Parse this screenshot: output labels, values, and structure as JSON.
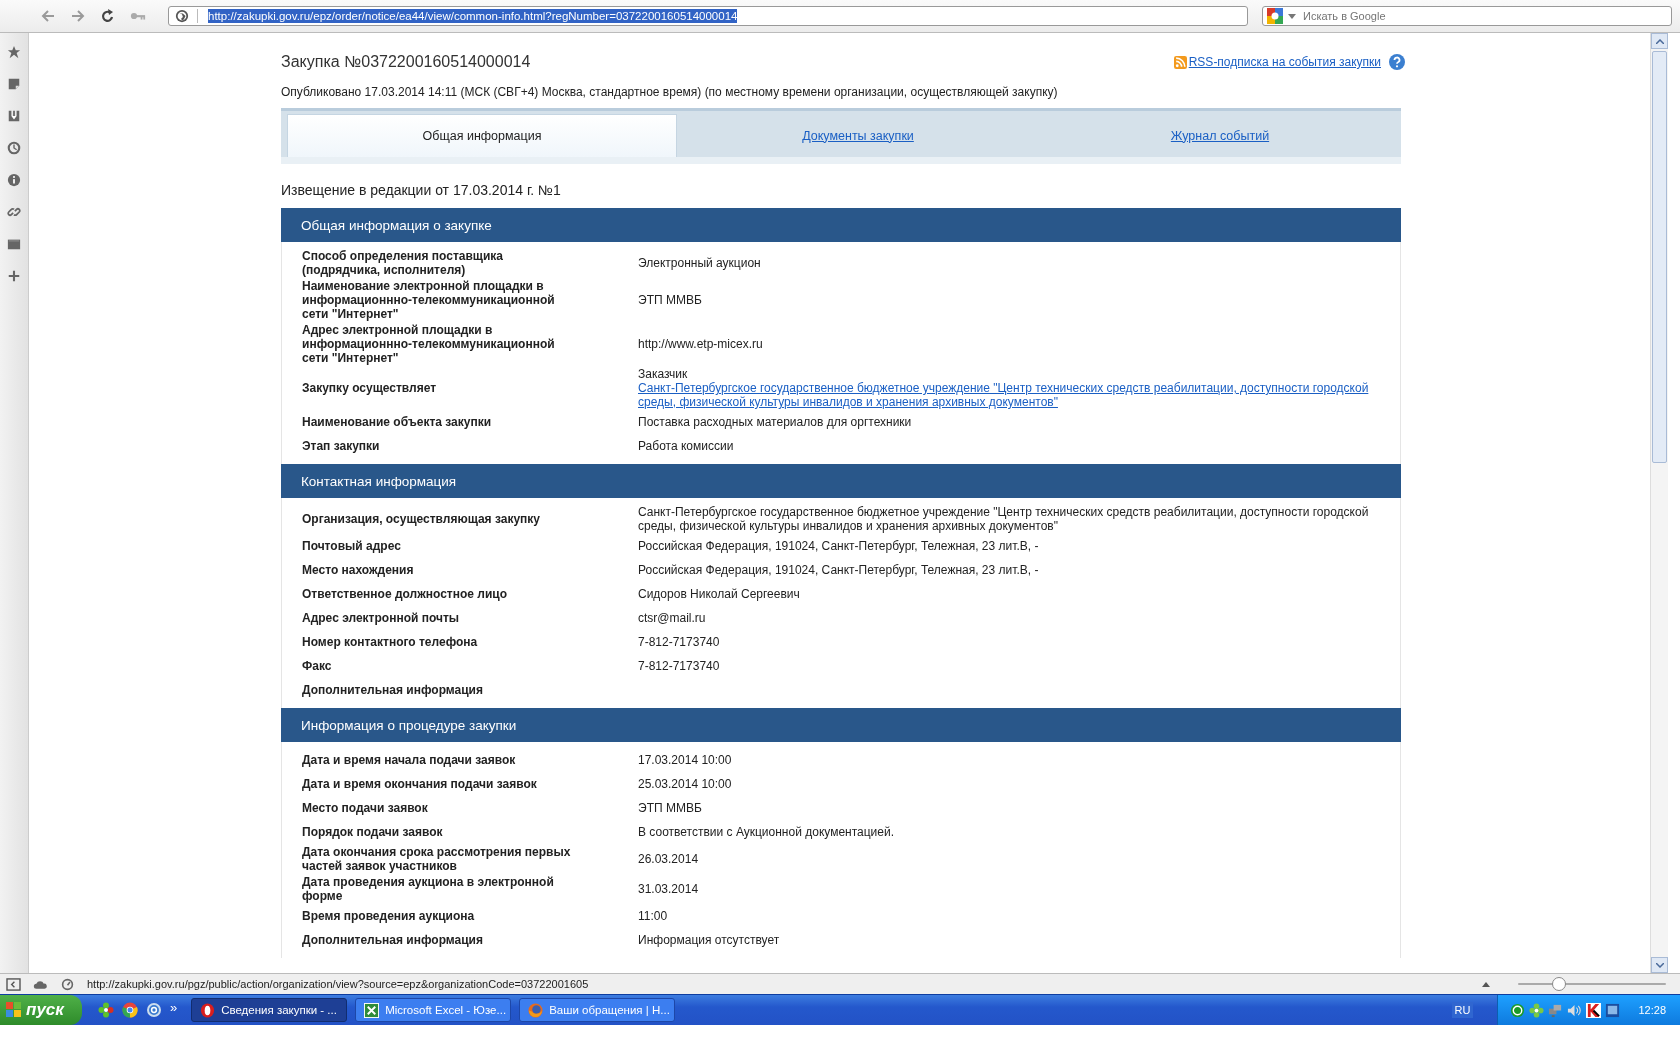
{
  "browser": {
    "address": "http://zakupki.gov.ru/epz/order/notice/ea44/view/common-info.html?regNumber=0372200160514000014",
    "search": {
      "placeholder": "Искать в Google"
    }
  },
  "page": {
    "title": "Закупка №0372200160514000014",
    "rss_link": "RSS-подписка на события закупки",
    "published": "Опубликовано 17.03.2014 14:11 (МСК (СВГ+4) Москва, стандартное время) (по местному времени организации, осуществляющей закупку)",
    "tabs": [
      {
        "label": "Общая информация",
        "selected": true
      },
      {
        "label": "Документы закупки",
        "selected": false
      },
      {
        "label": "Журнал событий",
        "selected": false
      }
    ],
    "notice": "Извещение в редакции от 17.03.2014 г. №1",
    "sections": [
      {
        "title": "Общая информация о закупке",
        "rows": [
          {
            "label": "Способ определения поставщика (подрядчика, исполнителя)",
            "value": "Электронный аукцион",
            "link": false
          },
          {
            "label": "Наименование электронной площадки в информационнно-телекоммуникационной сети \"Интернет\"",
            "value": "ЭТП ММВБ",
            "link": false
          },
          {
            "label": "Адрес электронной площадки в информационнно-телекоммуникационной сети \"Интернет\"",
            "value": "http://www.etp-micex.ru",
            "link": false
          },
          {
            "label": "Закупку осуществляет",
            "note": "Заказчик",
            "value": "Санкт-Петербургское государственное бюджетное учреждение \"Центр технических средств реабилитации, доступности городской среды, физической культуры инвалидов и хранения архивных документов\"",
            "link": true
          },
          {
            "label": "Наименование объекта закупки",
            "value": "Поставка расходных материалов для оргтехники",
            "link": false
          },
          {
            "label": "Этап закупки",
            "value": "Работа комиссии",
            "link": false
          }
        ]
      },
      {
        "title": "Контактная информация",
        "rows": [
          {
            "label": "Организация, осуществляющая закупку",
            "value": "Санкт-Петербургское государственное бюджетное учреждение \"Центр технических средств реабилитации, доступности городской среды, физической культуры инвалидов и хранения архивных документов\"",
            "link": false
          },
          {
            "label": "Почтовый адрес",
            "value": "Российская Федерация, 191024, Санкт-Петербург, Тележная, 23 лит.В, -",
            "link": false
          },
          {
            "label": "Место нахождения",
            "value": "Российская Федерация, 191024, Санкт-Петербург, Тележная, 23 лит.В, -",
            "link": false
          },
          {
            "label": "Ответственное должностное лицо",
            "value": "Сидоров Николай Сергеевич",
            "link": false
          },
          {
            "label": "Адрес электронной почты",
            "value": "ctsr@mail.ru",
            "link": false
          },
          {
            "label": "Номер контактного телефона",
            "value": "7-812-7173740",
            "link": false
          },
          {
            "label": "Факс",
            "value": "7-812-7173740",
            "link": false
          },
          {
            "label": "Дополнительная информация"
          }
        ]
      },
      {
        "title": "Информация о процедуре закупки",
        "rows": [
          {
            "label": "Дата и время начала подачи заявок",
            "value": "17.03.2014 10:00",
            "link": false
          },
          {
            "label": "Дата и время окончания подачи заявок",
            "value": "25.03.2014 10:00",
            "link": false
          },
          {
            "label": "Место подачи заявок",
            "value": "ЭТП ММВБ",
            "link": false
          },
          {
            "label": "Порядок подачи заявок",
            "value": "В соответствии с Аукционной документацией.",
            "link": false
          },
          {
            "label": "Дата окончания срока рассмотрения первых частей заявок участников",
            "value": "26.03.2014",
            "link": false
          },
          {
            "label": "Дата проведения аукциона в электронной форме",
            "value": "31.03.2014",
            "link": false
          },
          {
            "label": "Время проведения аукциона",
            "value": "11:00",
            "link": false
          },
          {
            "label": "Дополнительная информация",
            "value": "Информация отсутствует",
            "link": false
          }
        ]
      }
    ]
  },
  "status_bar": {
    "url": "http://zakupki.gov.ru/pgz/public/action/organization/view?source=epz&organizationCode=03722001605",
    "zoom": {
      "level": 0.28
    }
  },
  "taskbar": {
    "start": "пуск",
    "more": "»",
    "tasks": [
      {
        "label": "Сведения закупки - ...",
        "kind": "opera",
        "selected": true
      },
      {
        "label": "Microsoft Excel - Юзе...",
        "kind": "excel",
        "selected": false
      },
      {
        "label": "Ваши обращения | Н...",
        "kind": "firefox",
        "selected": false
      }
    ],
    "language": "RU",
    "clock": "12:28"
  }
}
